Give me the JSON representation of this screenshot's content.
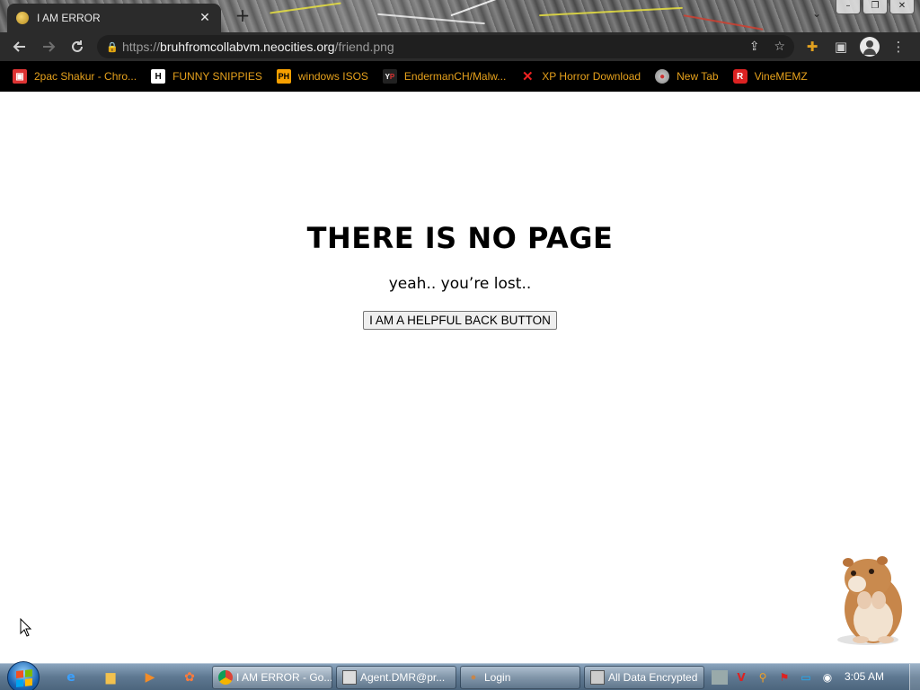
{
  "browser": {
    "tab_title": "I AM ERROR",
    "tab_close": "✕",
    "new_tab": "+",
    "url_scheme": "https://",
    "url_host": "bruhfromcollabvm.neocities.org",
    "url_path": "/friend.png"
  },
  "bookmarks": [
    {
      "label": "2pac Shakur - Chro...",
      "icon": "gift-icon"
    },
    {
      "label": "FUNNY SNIPPIES",
      "icon": "h-letter-icon"
    },
    {
      "label": "windows ISOS",
      "icon": "ph-logo-icon"
    },
    {
      "label": "EndermanCH/Malw...",
      "icon": "yp-logo-icon"
    },
    {
      "label": "XP Horror Download",
      "icon": "red-x-icon"
    },
    {
      "label": "New Tab",
      "icon": "globe-icon"
    },
    {
      "label": "VineMEMZ",
      "icon": "r-logo-icon"
    }
  ],
  "page": {
    "heading": "THERE IS NO PAGE",
    "subtext": "yeah.. you’re lost..",
    "back_button": "I AM A HELPFUL BACK BUTTON"
  },
  "taskbar": {
    "tasks": [
      {
        "label": "I AM ERROR - Go...",
        "icon": "chrome-icon"
      },
      {
        "label": "Agent.DMR@pr...",
        "icon": "window-icon"
      },
      {
        "label": "Login",
        "icon": "hamster-icon"
      },
      {
        "label": "All Data Encrypted",
        "icon": "window-icon"
      }
    ],
    "clock": "3:05 AM"
  },
  "colors": {
    "bookmark_text": "#e6a11c",
    "toolbar_bg": "#2b2b2b",
    "bookmarks_bg": "#000000",
    "page_bg": "#ffffff"
  }
}
